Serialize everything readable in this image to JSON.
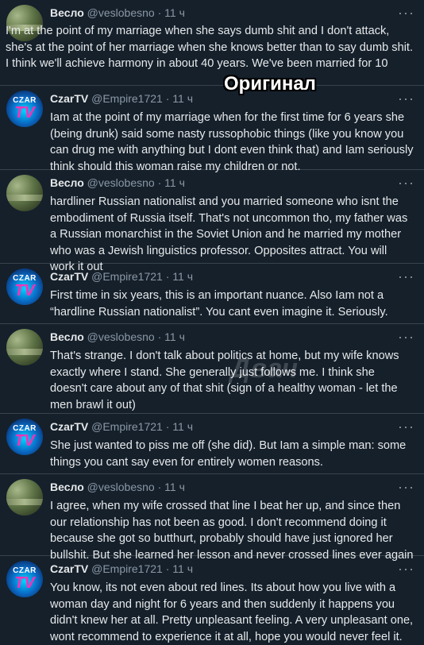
{
  "overlay_title": "Оригинал",
  "watermark": "Двач",
  "menu_icon": "more-dots-icon",
  "tweets": [
    {
      "name": "Весло",
      "handle": "@veslobesno",
      "time": "11 ч",
      "avatar": "landscape-avatar",
      "text": "I'm at the point of my marriage when she says dumb shit and I don't attack, she's at the point of her marriage when she knows better than to say dumb shit. I think we'll achieve harmony in about 40 years. We've been married for 10"
    },
    {
      "name": "CzarTV",
      "handle": "@Empire1721",
      "time": "11 ч",
      "avatar": "czartv-logo-avatar",
      "avatar_text_1": "CZAR",
      "avatar_text_2": "TV",
      "text": "Iam at the point of my marriage when for the first time for 6 years she (being drunk) said some nasty russophobic things (like you know you can drug me with anything but I dont even think that) and Iam seriously think should this woman raise my children or not."
    },
    {
      "name": "Весло",
      "handle": "@veslobesno",
      "time": "11 ч",
      "avatar": "landscape-avatar",
      "text": "hardliner Russian nationalist and you married someone who isnt the embodiment of Russia itself. That's not uncommon tho, my father was a Russian monarchist in the Soviet Union and he married my mother who was a Jewish linguistics professor. Opposites attract. You will work it out"
    },
    {
      "name": "CzarTV",
      "handle": "@Empire1721",
      "time": "11 ч",
      "avatar": "czartv-logo-avatar",
      "avatar_text_1": "CZAR",
      "avatar_text_2": "TV",
      "text": "First time in six years, this is an important nuance. Also Iam not a “hardline Russian nationalist”. You cant even imagine it. Seriously."
    },
    {
      "name": "Весло",
      "handle": "@veslobesno",
      "time": "11 ч",
      "avatar": "landscape-avatar",
      "text": "That's strange. I don't talk about politics at home, but my wife knows exactly where I stand. She generally just follows me. I think she doesn't care about any of that shit (sign of a healthy woman - let the men brawl it out)"
    },
    {
      "name": "CzarTV",
      "handle": "@Empire1721",
      "time": "11 ч",
      "avatar": "czartv-logo-avatar",
      "avatar_text_1": "CZAR",
      "avatar_text_2": "TV",
      "text": "She just wanted to piss me off (she did). But Iam a simple man: some things you cant say even for entirely women reasons."
    },
    {
      "name": "Весло",
      "handle": "@veslobesno",
      "time": "11 ч",
      "avatar": "landscape-avatar",
      "text": "I agree, when my wife crossed that line I beat her up, and since then our relationship has not been as good. I don't recommend doing it because she got so butthurt, probably should have just ignored her bullshit. But she learned her lesson and never crossed lines ever again"
    },
    {
      "name": "CzarTV",
      "handle": "@Empire1721",
      "time": "11 ч",
      "avatar": "czartv-logo-avatar",
      "avatar_text_1": "CZAR",
      "avatar_text_2": "TV",
      "text": "You know, its not even about red lines. Its about how you live with a woman day and night for 6 years and then suddenly it happens you didn't knew her at all. Pretty unpleasant feeling. A very unpleasant one, wont recommend to experience it at all, hope you would never feel it."
    }
  ]
}
